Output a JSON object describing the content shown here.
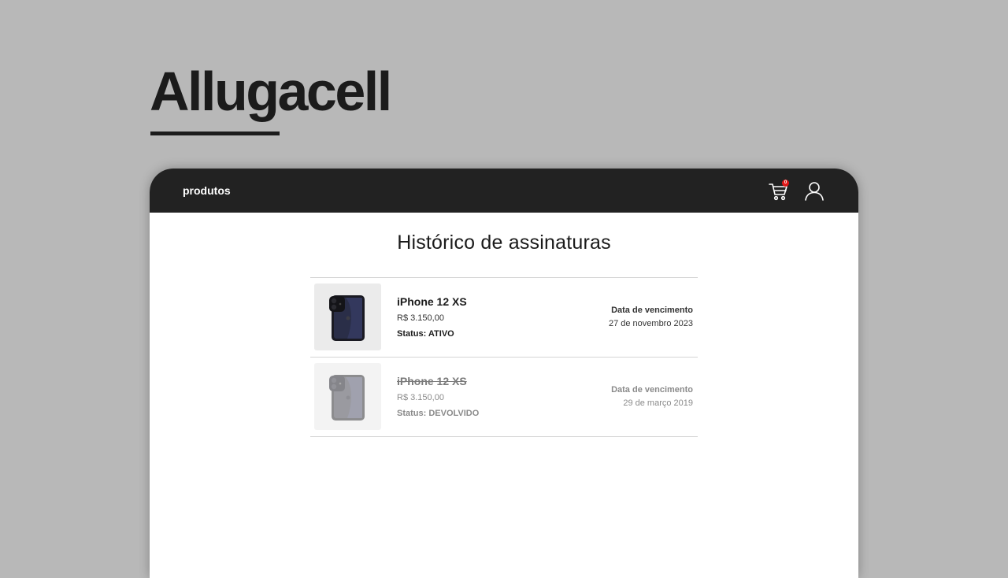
{
  "brand": {
    "name": "Allugacell"
  },
  "nav": {
    "products_label": "produtos",
    "cart_count": "0",
    "cart_icon": "cart-icon",
    "user_icon": "user-icon"
  },
  "page": {
    "title": "Histórico de assinaturas"
  },
  "subscriptions": [
    {
      "product": "iPhone 12 XS",
      "price": "R$ 3.150,00",
      "status": "Status: ATIVO",
      "due_label": "Data de vencimento",
      "due_date": "27 de novembro 2023"
    },
    {
      "product": "iPhone 12 XS",
      "price": "R$ 3.150,00",
      "status": "Status: DEVOLVIDO",
      "due_label": "Data de vencimento",
      "due_date": "29 de março 2019"
    }
  ],
  "colors": {
    "background": "#b8b8b8",
    "navbar": "#222222",
    "badge": "#e01818",
    "text": "#1b1b1b",
    "muted_text": "#8a8a8a"
  }
}
